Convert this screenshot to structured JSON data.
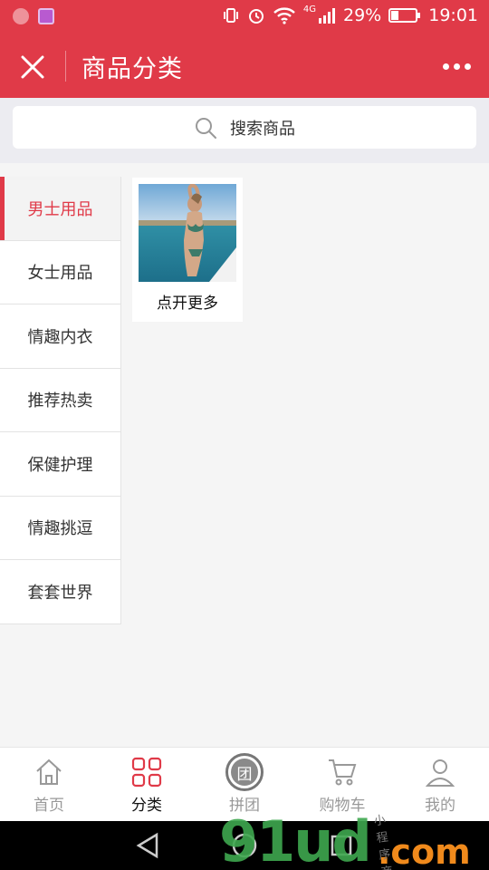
{
  "status_bar": {
    "battery_percent": "29%",
    "battery_level": 0.29,
    "time": "19:01",
    "network": "4G",
    "icons": [
      "app-icon",
      "gallery-icon",
      "vibrate-icon",
      "alarm-icon",
      "wifi-icon",
      "signal-icon",
      "battery-icon"
    ]
  },
  "header": {
    "title": "商品分类",
    "close_icon": "close-icon",
    "more_icon": "more-dots-icon"
  },
  "search": {
    "placeholder": "搜索商品"
  },
  "sidebar": {
    "items": [
      {
        "label": "男士用品",
        "active": true
      },
      {
        "label": "女士用品",
        "active": false
      },
      {
        "label": "情趣内衣",
        "active": false
      },
      {
        "label": "推荐热卖",
        "active": false
      },
      {
        "label": "保健护理",
        "active": false
      },
      {
        "label": "情趣挑逗",
        "active": false
      },
      {
        "label": "套套世界",
        "active": false
      }
    ]
  },
  "content": {
    "card": {
      "label": "点开更多",
      "image": "product-photo"
    }
  },
  "bottom_nav": {
    "items": [
      {
        "label": "首页",
        "icon": "home-icon",
        "active": false
      },
      {
        "label": "分类",
        "icon": "category-grid-icon",
        "active": true
      },
      {
        "label": "拼团",
        "icon": "group-buy-icon",
        "active": false
      },
      {
        "label": "购物车",
        "icon": "cart-icon",
        "active": false
      },
      {
        "label": "我的",
        "icon": "user-icon",
        "active": false
      }
    ],
    "group_badge": "团"
  },
  "watermark": {
    "main": "91ud",
    "suffix": ".com",
    "tag": "小程序商店"
  },
  "colors": {
    "brand": "#e03a48",
    "background": "#f5f5f5"
  }
}
